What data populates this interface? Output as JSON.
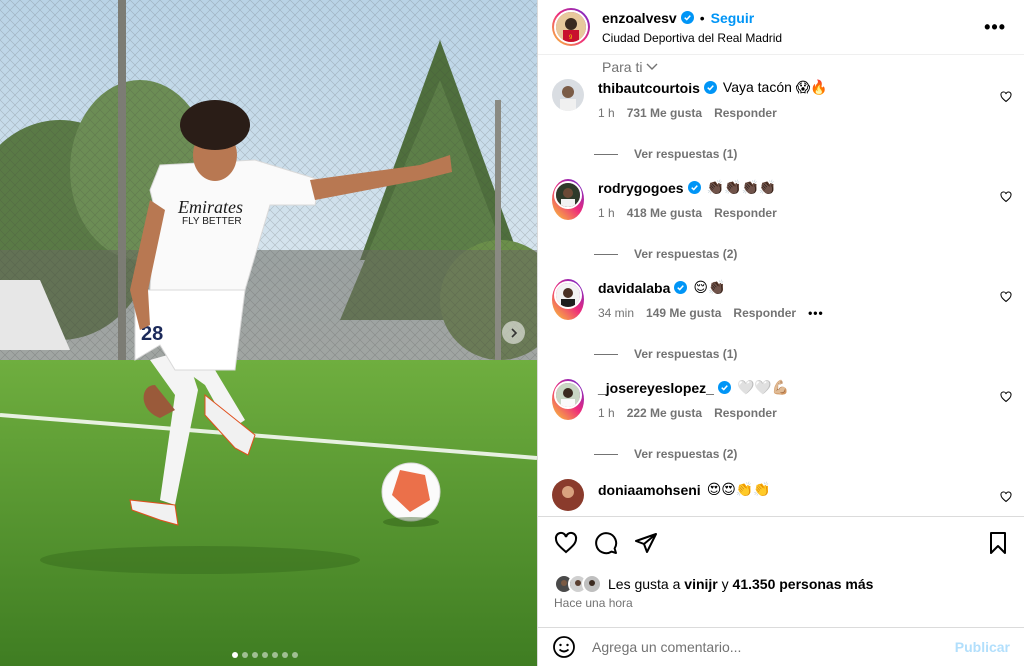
{
  "post": {
    "username": "enzoalvesv",
    "separator": "•",
    "follow_label": "Seguir",
    "location": "Ciudad Deportiva del Real Madrid",
    "more_label": "•••"
  },
  "media": {
    "shirt_sponsor_line1": "Emirates",
    "shirt_sponsor_line2": "FLY BETTER",
    "shirt_number": "28",
    "carousel_count": 7,
    "carousel_active_index": 0
  },
  "filter_label": "Para ti",
  "comments": [
    {
      "user": "thibautcourtois",
      "text": "Vaya tacón 😱🔥",
      "time": "1 h",
      "likes": "731 Me gusta",
      "reply": "Responder",
      "view_replies": "Ver respuestas (1)"
    },
    {
      "user": "rodrygogoes",
      "text": "👏🏿👏🏿👏🏿👏🏿",
      "time": "1 h",
      "likes": "418 Me gusta",
      "reply": "Responder",
      "view_replies": "Ver respuestas (2)"
    },
    {
      "user": "davidalaba",
      "text": "😌👏🏿",
      "time": "34 min",
      "likes": "149 Me gusta",
      "reply": "Responder",
      "more": "•••",
      "view_replies": "Ver respuestas (1)"
    },
    {
      "user": "_josereyeslopez_",
      "text": "🤍🤍💪🏼",
      "time": "1 h",
      "likes": "222 Me gusta",
      "reply": "Responder",
      "view_replies": "Ver respuestas (2)"
    },
    {
      "user": "doniaamohseni",
      "text": "😍😍👏👏"
    }
  ],
  "likes": {
    "prefix": "Les gusta a",
    "user": "vinijr",
    "middle": "y",
    "count": "41.350 personas más"
  },
  "time_ago": "Hace una hora",
  "add_comment": {
    "placeholder": "Agrega un comentario...",
    "publish_label": "Publicar"
  },
  "colors": {
    "accent": "#0095f6",
    "verified": "#0095f6",
    "publish_disabled": "#b2dffc",
    "muted": "#737373"
  }
}
